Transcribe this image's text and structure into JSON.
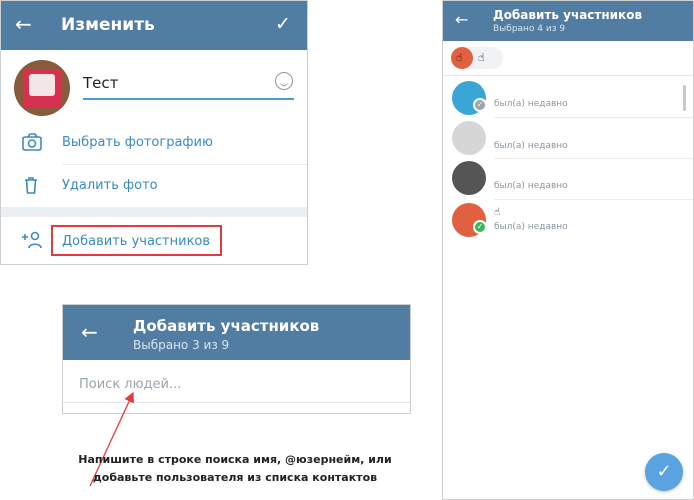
{
  "edit_panel": {
    "title": "Изменить",
    "back_icon": "arrow-left-icon",
    "confirm_icon": "check-icon",
    "group_name": "Тест",
    "choose_photo_label": "Выбрать фотографию",
    "delete_photo_label": "Удалить фото",
    "add_members_label": "Добавить участников",
    "highlight_color": "#e33b3b"
  },
  "add_members_panel": {
    "title": "Добавить участников",
    "subtitle": "Выбрано 3 из 9",
    "search_placeholder": "Поиск людей..."
  },
  "instruction_text": "Напишите в строке поиска имя, @юзернейм, или добавьте пользователя из списка контактов",
  "members_panel": {
    "title": "Добавить участников",
    "subtitle": "Выбрано 4 из 9",
    "selected_chip_emoji": "☝",
    "contacts": [
      {
        "name": "",
        "status": "был(а) недавно",
        "avatar_color": "#3aa6d8",
        "selected": true
      },
      {
        "name": "",
        "status": "был(а) недавно",
        "avatar_color": "#d6d6d6",
        "selected": false
      },
      {
        "name": "",
        "status": "был(а) недавно",
        "avatar_color": "#555555",
        "selected": false
      },
      {
        "name": "☝",
        "status": "был(а) недавно",
        "avatar_color": "#e06040",
        "selected": true
      }
    ],
    "fab_icon": "check-icon"
  },
  "colors": {
    "header": "#527da3",
    "accent": "#3a8ac2",
    "fab": "#5aa3e0"
  }
}
